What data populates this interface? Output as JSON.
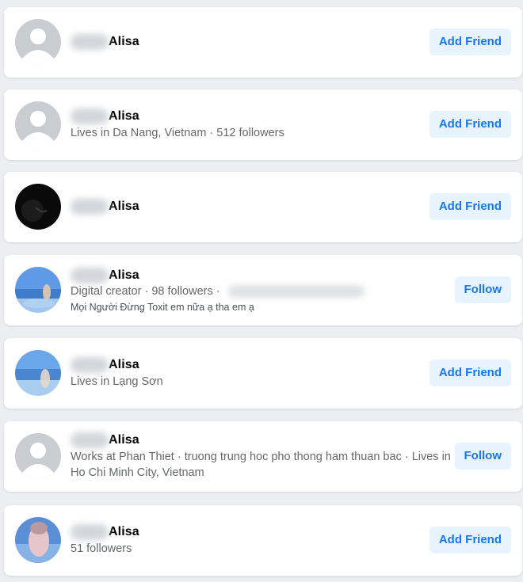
{
  "results": [
    {
      "name": "Alisa",
      "avatar": "default-avatar",
      "subtitle": "",
      "subtitle2": "",
      "button": "Add Friend"
    },
    {
      "name": "Alisa",
      "avatar": "default-avatar",
      "subtitle": "Lives in Da Nang, Vietnam · 512 followers",
      "subtitle2": "",
      "button": "Add Friend"
    },
    {
      "name": "Alisa",
      "avatar": "dark-photo-avatar",
      "subtitle": "",
      "subtitle2": "",
      "button": "Add Friend"
    },
    {
      "name": "Alisa",
      "avatar": "beach-photo-avatar",
      "subtitle": "Digital creator · 98 followers ·",
      "subtitle2": "Mọi Người Đừng Toxit em nữa ạ tha em ạ",
      "button": "Follow"
    },
    {
      "name": "Alisa",
      "avatar": "sea-photo-avatar",
      "subtitle": "Lives in Lạng Sơn",
      "subtitle2": "",
      "button": "Add Friend"
    },
    {
      "name": "Alisa",
      "avatar": "default-avatar",
      "subtitle": "Works at Phan Thiet · truong trung hoc pho thong ham thuan bac · Lives in Ho Chi Minh City, Vietnam",
      "subtitle2": "",
      "button": "Follow"
    },
    {
      "name": "Alisa",
      "avatar": "portrait-photo-avatar",
      "subtitle": "51 followers",
      "subtitle2": "",
      "button": "Add Friend"
    }
  ],
  "colors": {
    "background": "#eceef2",
    "card": "#ffffff",
    "button_bg": "#e7f3ff",
    "button_text": "#1877f2",
    "secondary_text": "#65676b"
  }
}
